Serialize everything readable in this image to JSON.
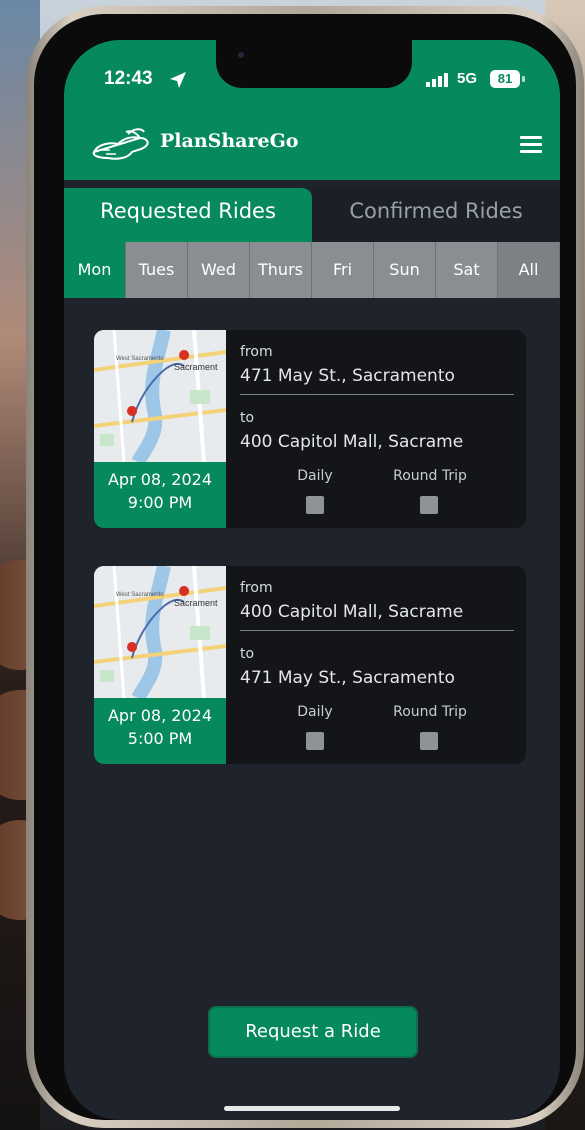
{
  "status": {
    "time": "12:43",
    "network": "5G",
    "battery": "81"
  },
  "app": {
    "brand": "PlanShareGo"
  },
  "tabs": [
    {
      "label": "Requested Rides",
      "active": true
    },
    {
      "label": "Confirmed Rides",
      "active": false
    }
  ],
  "days": [
    {
      "label": "Mon",
      "active": true
    },
    {
      "label": "Tues"
    },
    {
      "label": "Wed"
    },
    {
      "label": "Thurs"
    },
    {
      "label": "Fri"
    },
    {
      "label": "Sun"
    },
    {
      "label": "Sat"
    },
    {
      "label": "All"
    }
  ],
  "rides": [
    {
      "date": "Apr 08, 2024",
      "time": "9:00 PM",
      "from_label": "from",
      "from": "471 May St., Sacramento",
      "to_label": "to",
      "to": "400 Capitol Mall, Sacrame",
      "daily_label": "Daily",
      "round_trip_label": "Round Trip",
      "map_labels": [
        "West Sacramento",
        "Sacrament"
      ]
    },
    {
      "date": "Apr 08, 2024",
      "time": "5:00 PM",
      "from_label": "from",
      "from": "400 Capitol Mall, Sacrame",
      "to_label": "to",
      "to": "471 May St., Sacramento",
      "daily_label": "Daily",
      "round_trip_label": "Round Trip",
      "map_labels": [
        "West Sacramento",
        "Sacrament"
      ]
    }
  ],
  "actions": {
    "request_ride": "Request a Ride"
  },
  "colors": {
    "primary": "#068a5c",
    "background": "#1f232b",
    "card": "#131518",
    "day_inactive": "#8a8d92"
  }
}
